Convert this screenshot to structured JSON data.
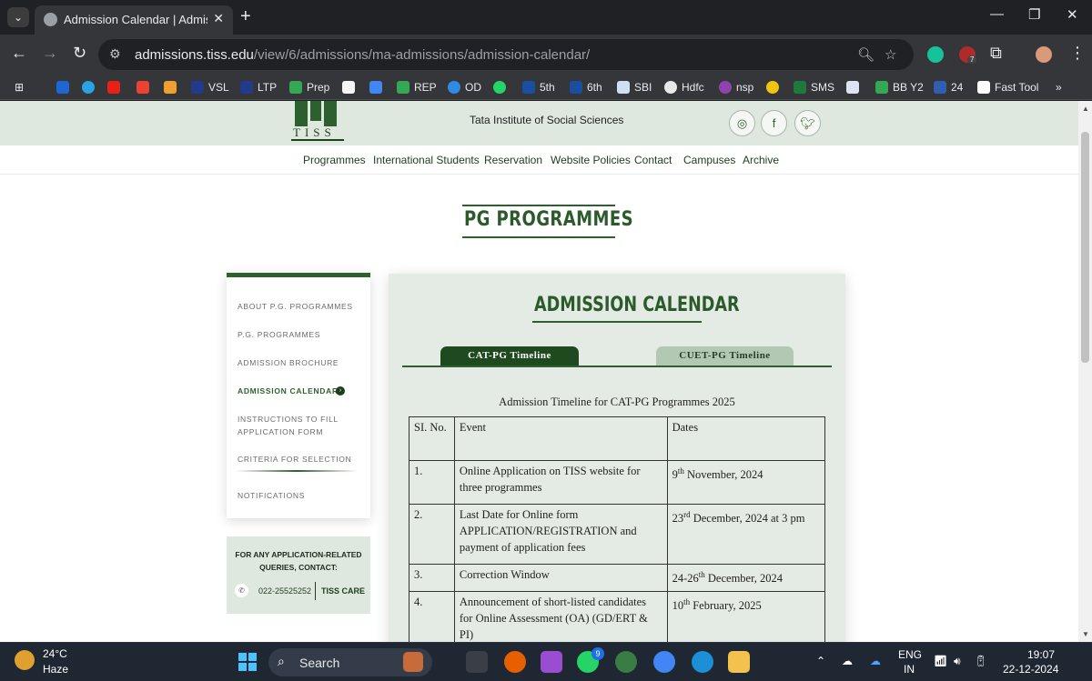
{
  "browser": {
    "tab_title": "Admission Calendar | Admission",
    "url_host": "admissions.tiss.edu",
    "url_path": "/view/6/admissions/ma-admissions/admission-calendar/",
    "bookmarks": [
      "VSL",
      "LTP",
      "Prep",
      "REP",
      "OD",
      "5th",
      "6th",
      "SBI",
      "Hdfc",
      "nsp",
      "SMS",
      "BB Y2",
      "24",
      "Fast Tool"
    ],
    "extension_badge": "7"
  },
  "site": {
    "logo_text": "TISS",
    "name": "Tata Institute of Social Sciences",
    "social": [
      "instagram-icon",
      "facebook-icon",
      "twitter-icon"
    ],
    "nav": [
      "Programmes",
      "International Students",
      "Reservation",
      "Website Policies",
      "Contact",
      "Campuses",
      "Archive"
    ]
  },
  "page_title": "PG PROGRAMMES",
  "sidebar": {
    "items": [
      "ABOUT P.G. PROGRAMMES",
      "P.G. PROGRAMMES",
      "ADMISSION BROCHURE",
      "ADMISSION CALENDAR",
      "INSTRUCTIONS TO FILL",
      "APPLICATION FORM",
      "CRITERIA FOR SELECTION",
      "NOTIFICATIONS"
    ]
  },
  "contact": {
    "line1": "FOR ANY APPLICATION-RELATED",
    "line2": "QUERIES, CONTACT:",
    "phone": "022-25525252",
    "care": "TISS CARE"
  },
  "calendar": {
    "title": "ADMISSION CALENDAR",
    "tabs": [
      "CAT-PG Timeline",
      "CUET-PG Timeline"
    ],
    "heading": "Admission Timeline for CAT-PG Programmes 2025",
    "columns": [
      "SI. No.",
      "Event",
      "Dates"
    ],
    "rows": [
      {
        "no": "1.",
        "event": "Online Application on TISS website for three programmes",
        "date_pre": "9",
        "date_sup": "th",
        "date_post": " November, 2024"
      },
      {
        "no": "2.",
        "event": "Last Date for Online form APPLICATION/REGISTRATION and payment of application fees",
        "date_pre": "23",
        "date_sup": "rd",
        "date_post": " December, 2024 at 3 pm"
      },
      {
        "no": "3.",
        "event": "Correction Window",
        "date_pre": "24-26",
        "date_sup": "th",
        "date_post": " December, 2024"
      },
      {
        "no": "4.",
        "event": "Announcement of short-listed candidates for Online Assessment (OA) (GD/ERT & PI)",
        "date_pre": "10",
        "date_sup": "th",
        "date_post": " February, 2025"
      }
    ]
  },
  "taskbar": {
    "temp": "24°C",
    "weather": "Haze",
    "search": "Search",
    "whatsapp_badge": "9",
    "lang1": "ENG",
    "lang2": "IN",
    "time": "19:07",
    "date": "22-12-2024"
  }
}
